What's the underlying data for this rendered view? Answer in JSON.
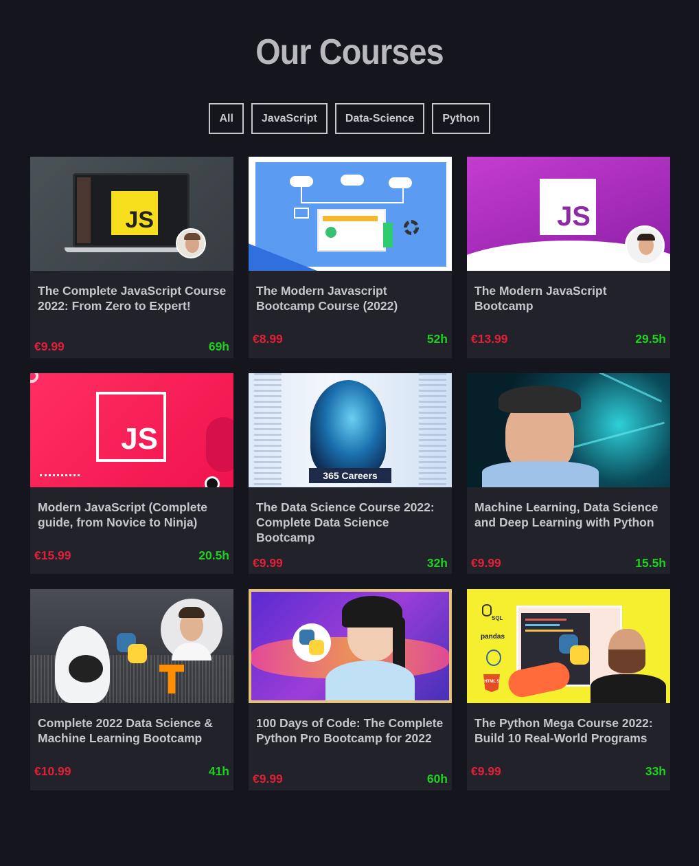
{
  "header": {
    "title": "Our Courses"
  },
  "filters": [
    "All",
    "JavaScript",
    "Data-Science",
    "Python"
  ],
  "courses": [
    {
      "title": "The Complete JavaScript Course 2022: From Zero to Expert!",
      "price": "€9.99",
      "hours": "69h"
    },
    {
      "title": "The Modern Javascript Bootcamp Course (2022)",
      "price": "€8.99",
      "hours": "52h"
    },
    {
      "title": "The Modern JavaScript Bootcamp",
      "price": "€13.99",
      "hours": "29.5h"
    },
    {
      "title": "Modern JavaScript (Complete guide, from Novice to Ninja)",
      "price": "€15.99",
      "hours": "20.5h"
    },
    {
      "title": "The Data Science Course 2022: Complete Data Science Bootcamp",
      "price": "€9.99",
      "hours": "32h"
    },
    {
      "title": "Machine Learning, Data Science and Deep Learning with Python",
      "price": "€9.99",
      "hours": "15.5h"
    },
    {
      "title": "Complete 2022 Data Science & Machine Learning Bootcamp",
      "price": "€10.99",
      "hours": "41h"
    },
    {
      "title": "100 Days of Code: The Complete Python Pro Bootcamp for 2022",
      "price": "€9.99",
      "hours": "60h"
    },
    {
      "title": "The Python Mega Course 2022: Build 10 Real-World Programs",
      "price": "€9.99",
      "hours": "33h"
    }
  ],
  "thumb_text": {
    "js": "JS",
    "careers": "365 Careers",
    "pandas": "pandas",
    "sql": "SQL",
    "html5": "HTML 5"
  },
  "colors": {
    "background": "#15151e",
    "card": "#22222b",
    "price": "#e0203a",
    "hours": "#1fd11f"
  }
}
